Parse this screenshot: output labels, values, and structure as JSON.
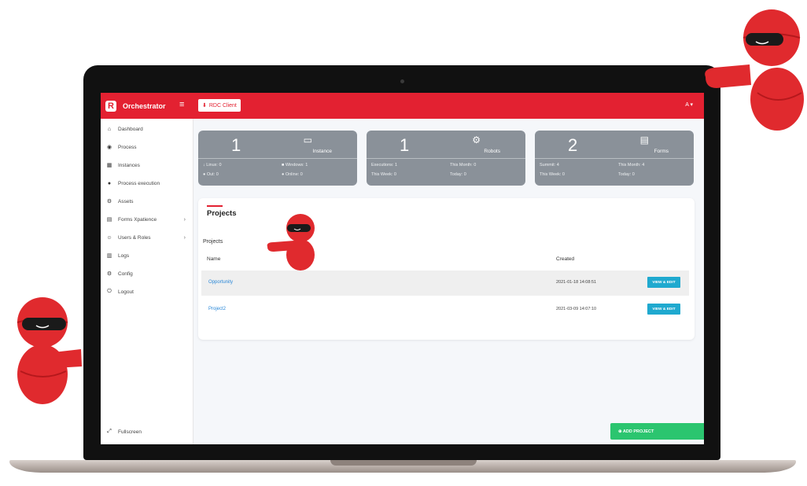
{
  "topbar": {
    "app_name": "Orchestrator",
    "rdc_button": "RDC Client",
    "user_menu": "A ▾"
  },
  "sidebar": {
    "items": [
      {
        "label": "Dashboard",
        "icon": "⌂",
        "icon_name": "home-icon"
      },
      {
        "label": "Process",
        "icon": "◉",
        "icon_name": "globe-icon"
      },
      {
        "label": "Instances",
        "icon": "▦",
        "icon_name": "grid-icon"
      },
      {
        "label": "Process execution",
        "icon": "●",
        "icon_name": "clock-icon"
      },
      {
        "label": "Assets",
        "icon": "⚙",
        "icon_name": "cogs-icon"
      },
      {
        "label": "Forms Xpatience",
        "icon": "▤",
        "icon_name": "form-icon",
        "chevron": "›"
      },
      {
        "label": "Users & Roles",
        "icon": "☺",
        "icon_name": "users-icon",
        "chevron": "›"
      },
      {
        "label": "Logs",
        "icon": "▥",
        "icon_name": "file-icon"
      },
      {
        "label": "Config",
        "icon": "⚙",
        "icon_name": "gear-icon"
      },
      {
        "label": "Logout",
        "icon": "⏻",
        "icon_name": "power-icon"
      }
    ],
    "fullscreen_label": "Fullscreen",
    "fullscreen_icon": "⤢"
  },
  "cards": [
    {
      "value": "1",
      "title": "Instance",
      "icon": "▭",
      "icon_name": "laptop-icon",
      "stats": [
        "↓ Linux: 0",
        "■ Windows: 1",
        "● Out: 0",
        "● Online: 0"
      ]
    },
    {
      "value": "1",
      "title": "Robots",
      "icon": "⚙",
      "icon_name": "android-icon",
      "stats": [
        "Executions: 1",
        "This Month: 0",
        "This Week: 0",
        "Today: 0"
      ]
    },
    {
      "value": "2",
      "title": "Forms",
      "icon": "▤",
      "icon_name": "clipboard-icon",
      "stats": [
        "Summit: 4",
        "This Month: 4",
        "This Week: 0",
        "Today: 0"
      ]
    }
  ],
  "projects": {
    "panel_title": "Projects",
    "sub_title": "Projects",
    "columns": [
      "Name",
      "Created"
    ],
    "rows": [
      {
        "name": "Opportunity",
        "created": "2021-01-18 14:08:51",
        "action": "VIEW & EDIT"
      },
      {
        "name": "Project2",
        "created": "2021-03-09 14:07:10",
        "action": "VIEW & EDIT"
      }
    ],
    "add_button": "⊕  ADD PROJECT"
  },
  "colors": {
    "brand_red": "#e32131",
    "card_gray": "#8a9199",
    "view_button": "#1fa9cf",
    "add_button": "#2bc56f"
  }
}
